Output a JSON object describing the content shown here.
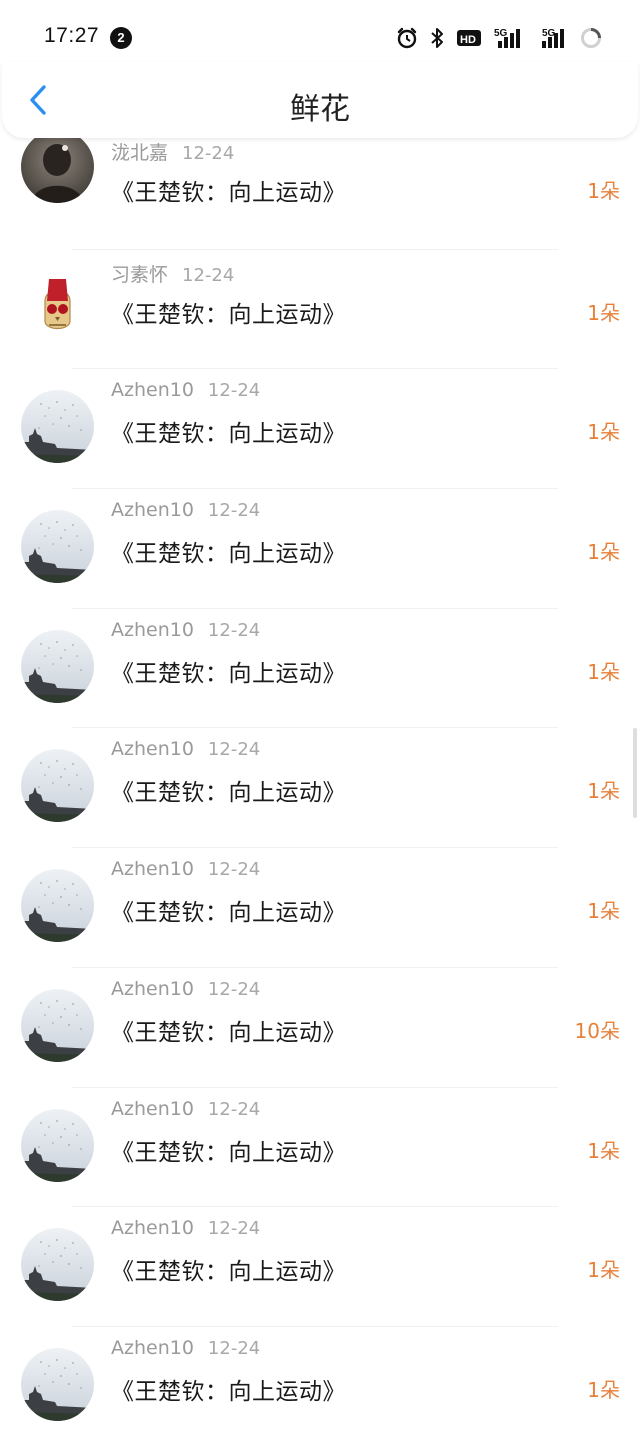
{
  "status": {
    "time": "17:27",
    "notification_count": "2",
    "hd_label": "HD",
    "net1": "5G",
    "net2": "5G"
  },
  "header": {
    "title": "鲜花"
  },
  "rows": [
    {
      "user": "泷北嘉",
      "date": "12-24",
      "title": "《王楚钦：向上运动》",
      "count": "1朵",
      "avatar": "dark-portrait"
    },
    {
      "user": "习素怀",
      "date": "12-24",
      "title": "《王楚钦：向上运动》",
      "count": "1朵",
      "avatar": "red-skull"
    },
    {
      "user": "Azhen10",
      "date": "12-24",
      "title": "《王楚钦：向上运动》",
      "count": "1朵",
      "avatar": "sky-building"
    },
    {
      "user": "Azhen10",
      "date": "12-24",
      "title": "《王楚钦：向上运动》",
      "count": "1朵",
      "avatar": "sky-building"
    },
    {
      "user": "Azhen10",
      "date": "12-24",
      "title": "《王楚钦：向上运动》",
      "count": "1朵",
      "avatar": "sky-building"
    },
    {
      "user": "Azhen10",
      "date": "12-24",
      "title": "《王楚钦：向上运动》",
      "count": "1朵",
      "avatar": "sky-building"
    },
    {
      "user": "Azhen10",
      "date": "12-24",
      "title": "《王楚钦：向上运动》",
      "count": "1朵",
      "avatar": "sky-building"
    },
    {
      "user": "Azhen10",
      "date": "12-24",
      "title": "《王楚钦：向上运动》",
      "count": "10朵",
      "avatar": "sky-building"
    },
    {
      "user": "Azhen10",
      "date": "12-24",
      "title": "《王楚钦：向上运动》",
      "count": "1朵",
      "avatar": "sky-building"
    },
    {
      "user": "Azhen10",
      "date": "12-24",
      "title": "《王楚钦：向上运动》",
      "count": "1朵",
      "avatar": "sky-building"
    },
    {
      "user": "Azhen10",
      "date": "12-24",
      "title": "《王楚钦：向上运动》",
      "count": "1朵",
      "avatar": "sky-building"
    }
  ],
  "colors": {
    "accent": "#2b8ff0",
    "count": "#e8803a"
  }
}
